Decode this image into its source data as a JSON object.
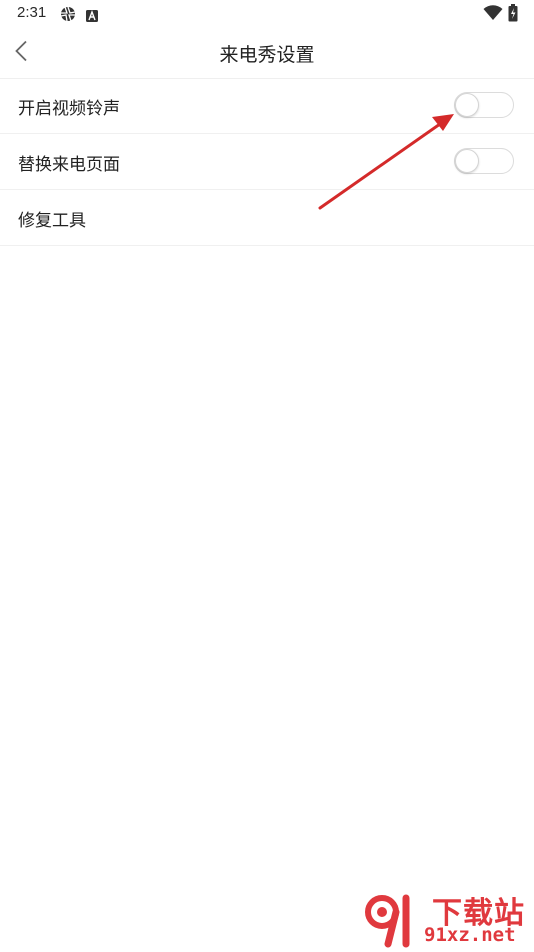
{
  "status_bar": {
    "time": "2:31",
    "icons": [
      "aperture-icon",
      "a-notification-icon",
      "wifi-icon",
      "battery-icon"
    ]
  },
  "header": {
    "title": "来电秀设置",
    "back_icon": "chevron-left-icon"
  },
  "settings": {
    "items": [
      {
        "label": "开启视频铃声",
        "type": "toggle",
        "enabled": false
      },
      {
        "label": "替换来电页面",
        "type": "toggle",
        "enabled": false
      },
      {
        "label": "修复工具",
        "type": "link"
      }
    ]
  },
  "watermark": {
    "cn": "下载站",
    "en": "91xz.net"
  },
  "colors": {
    "annotation_arrow": "#d42a2a",
    "watermark": "#e0393e",
    "toggle_border": "#dcdcdc"
  }
}
